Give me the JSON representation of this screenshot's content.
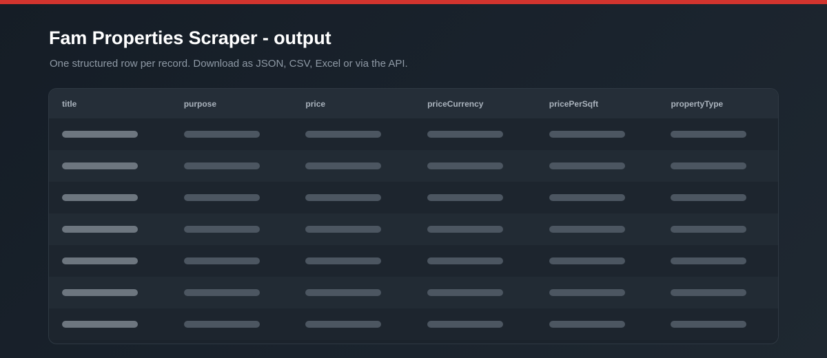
{
  "header": {
    "title": "Fam Properties Scraper - output",
    "subtitle": "One structured row per record. Download as JSON, CSV, Excel or via the API."
  },
  "table": {
    "columns": [
      "title",
      "purpose",
      "price",
      "priceCurrency",
      "pricePerSqft",
      "propertyType"
    ],
    "row_count": 7,
    "rows_state": "loading-placeholder"
  },
  "colors": {
    "accent": "#d2342e",
    "background": "#151d26",
    "header_bg": "#252e38",
    "skeleton_primary": "#6d767f",
    "skeleton_secondary": "#4c5661"
  }
}
